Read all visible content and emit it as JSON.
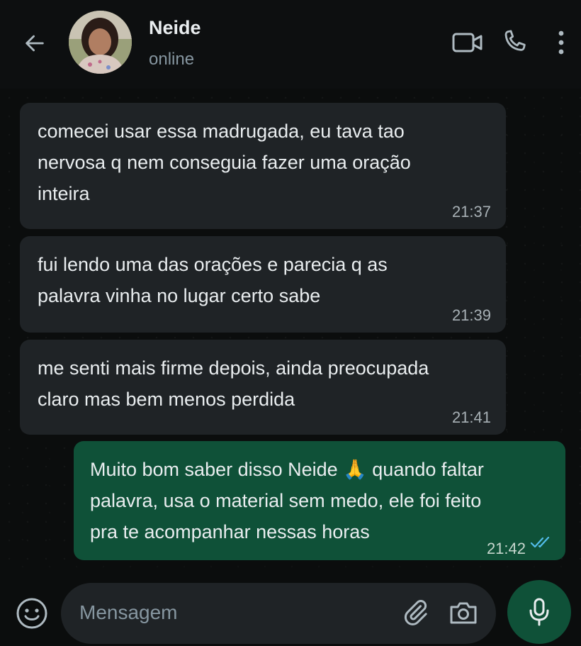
{
  "header": {
    "contact_name": "Neide",
    "status": "online"
  },
  "messages": [
    {
      "direction": "incoming",
      "text": "comecei usar essa madrugada, eu tava tao\nnervosa q nem conseguia fazer uma oração\ninteira",
      "time": "21:37"
    },
    {
      "direction": "incoming",
      "text": "fui lendo uma das orações e parecia q as\npalavra vinha no lugar certo sabe",
      "time": "21:39"
    },
    {
      "direction": "incoming",
      "text": "me senti mais firme depois, ainda preocupada\nclaro mas bem menos perdida",
      "time": "21:41"
    },
    {
      "direction": "outgoing",
      "text": "Muito bom saber disso Neide 🙏 quando faltar\npalavra, usa o material sem medo, ele foi feito\npra te acompanhar nessas horas",
      "time": "21:42",
      "read_status": "read"
    }
  ],
  "composer": {
    "placeholder": "Mensagem"
  },
  "icons": {
    "back": "arrow-left-icon",
    "video": "video-call-icon",
    "call": "phone-icon",
    "menu": "more-vertical-icon",
    "emoji": "emoji-icon",
    "attach": "paperclip-icon",
    "camera": "camera-icon",
    "mic": "microphone-icon",
    "read": "double-check-icon"
  },
  "colors": {
    "accent": "#0f5138",
    "incoming_bubble": "#1f2326",
    "read_ticks": "#53bdeb",
    "secondary_text": "#8696a0"
  }
}
